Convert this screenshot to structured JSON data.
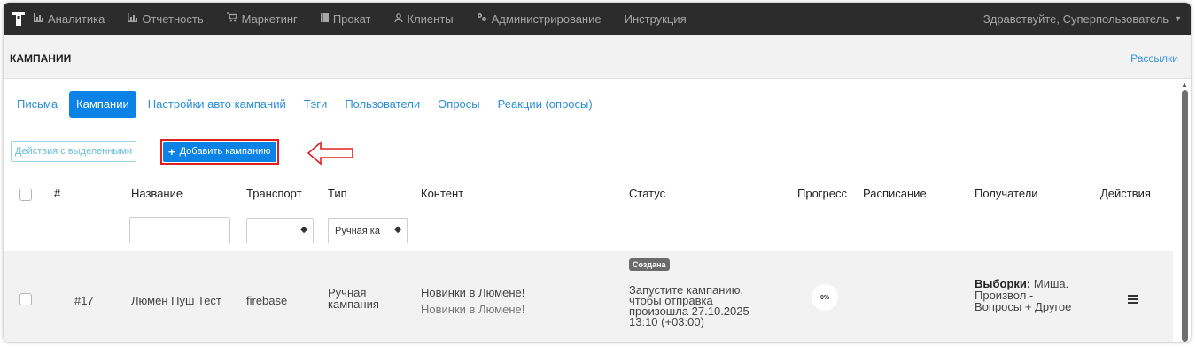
{
  "nav": {
    "items": [
      {
        "icon": "bar-chart-icon",
        "label": "Аналитика"
      },
      {
        "icon": "bar-chart-icon",
        "label": "Отчетность"
      },
      {
        "icon": "cart-icon",
        "label": "Маркетинг"
      },
      {
        "icon": "book-icon",
        "label": "Прокат"
      },
      {
        "icon": "user-icon",
        "label": "Клиенты"
      },
      {
        "icon": "gears-icon",
        "label": "Администрирование"
      },
      {
        "icon": "",
        "label": "Инструкция"
      }
    ],
    "greeting": "Здравствуйте, Суперпользователь"
  },
  "header": {
    "title": "КАМПАНИИ",
    "link": "Рассылки"
  },
  "tabs": [
    {
      "label": "Письма",
      "active": false
    },
    {
      "label": "Кампании",
      "active": true
    },
    {
      "label": "Настройки авто кампаний",
      "active": false
    },
    {
      "label": "Тэги",
      "active": false
    },
    {
      "label": "Пользователи",
      "active": false
    },
    {
      "label": "Опросы",
      "active": false
    },
    {
      "label": "Реакции (опросы)",
      "active": false
    }
  ],
  "toolbar": {
    "bulk_actions_label": "Действия с выделенными",
    "add_campaign_label": "Добавить кампанию"
  },
  "table": {
    "columns": [
      "#",
      "Название",
      "Транспорт",
      "Тип",
      "Контент",
      "Статус",
      "Прогресс",
      "Расписание",
      "Получатели",
      "Действия"
    ],
    "filters": {
      "name_value": "",
      "transport_value": "",
      "type_value": "Ручная ка"
    },
    "rows": [
      {
        "id": "#17",
        "name": "Люмен Пуш Тест",
        "transport": "firebase",
        "type_line1": "Ручная",
        "type_line2": "кампания",
        "content_title": "Новинки в Люмене!",
        "content_subtitle": "Новинки в Люмене!",
        "status_badge": "Создана",
        "status_line1": "Запустите кампанию,",
        "status_line2": "чтобы отправка",
        "status_line3": "произошла 27.10.2025",
        "status_line4": "13:10 (+03:00)",
        "progress": "0%",
        "schedule": "",
        "recipients_label": "Выборки:",
        "recipients_line1": "Миша.",
        "recipients_line2": "Произвол -",
        "recipients_line3": "Вопросы + Другое"
      }
    ]
  },
  "colors": {
    "nav_bg": "#2c2c2c",
    "primary": "#0b82e6",
    "link": "#2a8fd6",
    "highlight": "#e02020"
  }
}
